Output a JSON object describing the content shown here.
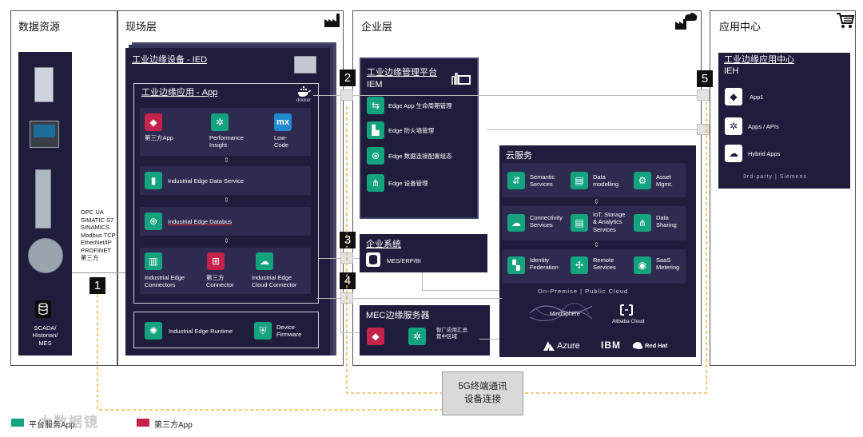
{
  "columns": {
    "data_sources": {
      "title": "数据资源"
    },
    "field": {
      "title": "现场层"
    },
    "enterprise": {
      "title": "企业层"
    },
    "app_center": {
      "title": "应用中心"
    }
  },
  "data_sources": {
    "scada_label": "SCADA/\nHistorian/\nMES"
  },
  "protocols": [
    "OPC UA",
    "SIMATIC S7",
    "SINAMICS",
    "Modbus TCP",
    "EtherNet/IP",
    "PROFINET",
    "第三方"
  ],
  "ied": {
    "title": "工业边缘设备 - IED",
    "app_title": "工业边缘应用 - App",
    "docker": "docker",
    "apps": [
      {
        "label": "第三方App",
        "icon": "diamond-icon"
      },
      {
        "label": "Performance\nInsight",
        "icon": "gear-icon"
      },
      {
        "label": "Low-\nCode",
        "icon": "mx-logo-icon",
        "glyph": "mx"
      }
    ],
    "data_service": "Industrial Edge Data Service",
    "databus": "Industrial Edge Databus",
    "connectors": [
      {
        "label": "Industrial Edge\nConnectors"
      },
      {
        "label": "第三方\nConnector"
      },
      {
        "label": "Industrial Edge\nCloud Connector"
      }
    ],
    "runtime": "Industrial Edge Runtime",
    "firmware": "Device\nFirmware"
  },
  "iem": {
    "title": "工业边缘管理平台",
    "subtitle": "IEM",
    "items": [
      "Edge App 生命周期管理",
      "Edge 防火墙管理",
      "Edge 数据连接配置组态",
      "Edge 设备管理"
    ]
  },
  "enterprise_sys": {
    "title": "企业系统",
    "item": "MES/ERP/BI"
  },
  "cloud": {
    "title": "云服务",
    "services": [
      "Semantic\nServices",
      "Data\nmodelling",
      "Asset\nMgmt.",
      "Connectivity\nServices",
      "IoT, Storage\n& Analytics\nServices",
      "Data\nSharing",
      "Identity\nFederation",
      "Remote\nServices",
      "SaaS\nMetering"
    ],
    "premise_label": "On-Premise | Public Cloud",
    "providers": [
      "MindSphere",
      "Alibaba Cloud",
      "Azure",
      "IBM",
      "Red Hat"
    ]
  },
  "mec": {
    "title": "MEC边缘服务器",
    "item": "智厂应用汇总\n管中区域"
  },
  "ieh": {
    "title": "工业边缘应用中心",
    "subtitle": "IEH",
    "items": [
      "App1",
      "Apps / APIs",
      "Hybrid Apps"
    ],
    "footer": "3rd-party | Siemens"
  },
  "fiveg": "5G终端通讯\n设备连接",
  "numbers": [
    "1",
    "2",
    "3",
    "4",
    "5"
  ],
  "legend": [
    {
      "label": "平台服务App",
      "color": "#14a37f"
    },
    {
      "label": "第三方App",
      "color": "#c4244b"
    }
  ],
  "watermark": "大数据镜",
  "colors": {
    "dark_panel": "#201c3c",
    "row": "#2e2a50",
    "green_tile": "#14a37f",
    "red_tile": "#c4244b",
    "orange_line": "#f0a93a"
  }
}
